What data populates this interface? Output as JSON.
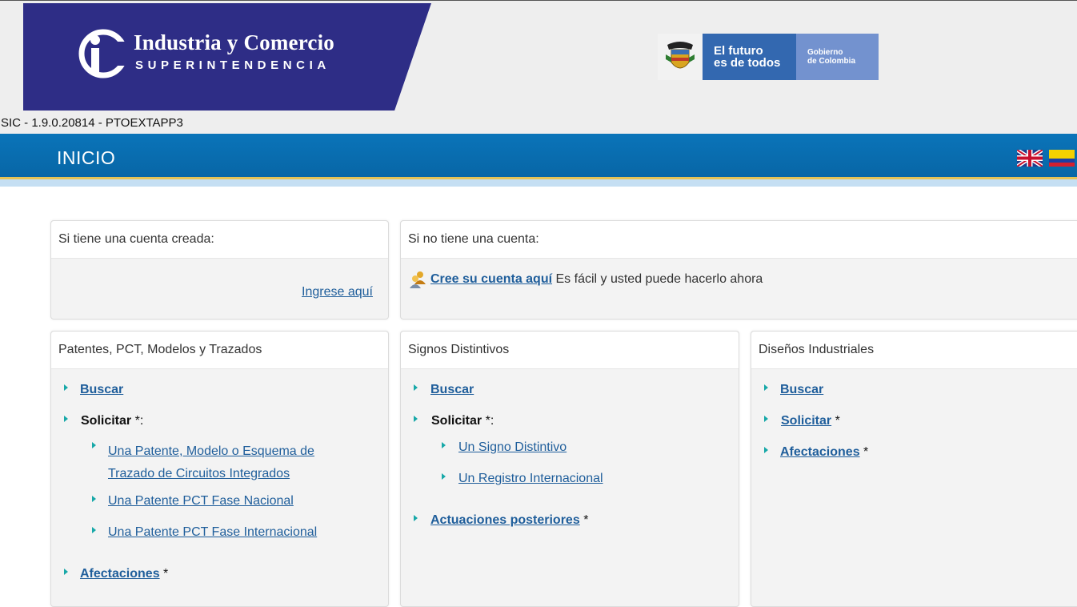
{
  "header": {
    "logo_title": "Industria y Comercio",
    "logo_subtitle": "SUPERINTENDENCIA",
    "gov_line1": "El futuro",
    "gov_line2": "es de todos",
    "gov_right1": "Gobierno",
    "gov_right2": "de Colombia",
    "version": "SIC - 1.9.0.20814 - PTOEXTAPP3"
  },
  "nav": {
    "title": "INICIO",
    "languages": [
      "english-flag",
      "colombia-flag"
    ]
  },
  "account": {
    "existing_title": "Si tiene una cuenta creada:",
    "login_link": "Ingrese aquí",
    "new_title": "Si no tiene una cuenta:",
    "create_link": "Cree su cuenta aquí",
    "create_text": "Es fácil y usted puede hacerlo ahora"
  },
  "patentes": {
    "title": "Patentes, PCT, Modelos y Trazados",
    "buscar": "Buscar",
    "solicitar": "Solicitar",
    "solicitar_suffix": "*:",
    "sub1_line1": "Una Patente, Modelo o Esquema de",
    "sub1_line2": "Trazado de Circuitos Integrados",
    "sub2": "Una Patente PCT Fase Nacional",
    "sub3": "Una Patente PCT Fase Internacional",
    "afectaciones": "Afectaciones",
    "afectaciones_star": "*"
  },
  "signos": {
    "title": "Signos Distintivos",
    "buscar": "Buscar",
    "solicitar": "Solicitar",
    "solicitar_suffix": "*:",
    "sub1": "Un Signo Distintivo",
    "sub2": "Un Registro Internacional",
    "actuaciones": "Actuaciones posteriores",
    "actuaciones_star": "*"
  },
  "disenos": {
    "title": "Diseños Industriales",
    "buscar": "Buscar",
    "solicitar": "Solicitar",
    "solicitar_star": "*",
    "afectaciones": "Afectaciones",
    "afectaciones_star": "*"
  },
  "colors": {
    "brand": "#2e2d86",
    "nav": "#0a74b9",
    "link": "#1f5e9b",
    "bullet": "#17a8a8"
  }
}
